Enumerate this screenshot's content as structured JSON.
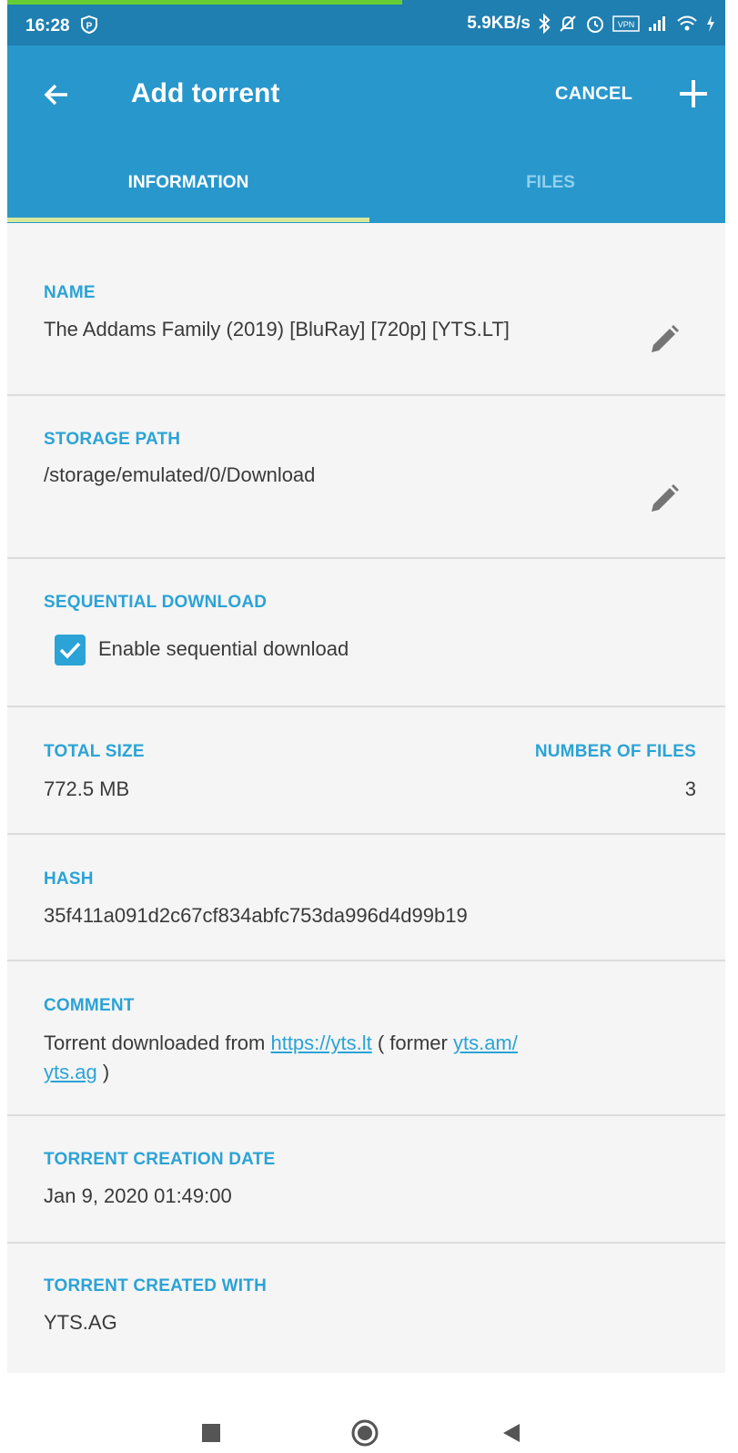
{
  "status_bar": {
    "time": "16:28",
    "speed": "5.9KB/s",
    "download_progress_fraction": 0.55,
    "icons": [
      "p-badge-icon",
      "bluetooth-icon",
      "mute-icon",
      "alarm-icon",
      "vpn-icon",
      "signal-icon",
      "wifi-icon",
      "charging-icon"
    ],
    "vpn_label": "VPN"
  },
  "app_bar": {
    "title": "Add torrent",
    "cancel_label": "CANCEL",
    "back_icon": "arrow-back-icon",
    "add_icon": "plus-icon",
    "tabs": [
      {
        "label": "INFORMATION",
        "active": true
      },
      {
        "label": "FILES",
        "active": false
      }
    ]
  },
  "fields": {
    "name": {
      "label": "NAME",
      "value": "The Addams Family (2019) [BluRay] [720p] [YTS.LT]"
    },
    "storage_path": {
      "label": "STORAGE PATH",
      "value": "/storage/emulated/0/Download"
    },
    "sequential": {
      "label": "SEQUENTIAL DOWNLOAD",
      "checkbox_label": "Enable sequential download",
      "checked": true
    },
    "total_size": {
      "label": "TOTAL SIZE",
      "value": "772.5 MB"
    },
    "number_of_files": {
      "label": "NUMBER OF FILES",
      "value": "3"
    },
    "hash": {
      "label": "HASH",
      "value": "35f411a091d2c67cf834abfc753da996d4d99b19"
    },
    "comment": {
      "label": "COMMENT",
      "text_before": "Torrent downloaded from ",
      "link1": "https://yts.lt",
      "text_middle": " ( former ",
      "link2": "yts.am/",
      "link3": "yts.ag",
      "text_after": " )"
    },
    "creation_date": {
      "label": "TORRENT CREATION DATE",
      "value": "Jan 9, 2020 01:49:00"
    },
    "created_with": {
      "label": "TORRENT CREATED WITH",
      "value": "YTS.AG"
    }
  },
  "colors": {
    "status_bar": "#1f7fb0",
    "app_bar": "#2897cc",
    "accent": "#2ba3d6",
    "tab_indicator": "#d8e89a",
    "progress": "#66cc33"
  },
  "nav_bar": {
    "icons": [
      "recents-square-icon",
      "home-circle-icon",
      "back-triangle-icon"
    ]
  }
}
